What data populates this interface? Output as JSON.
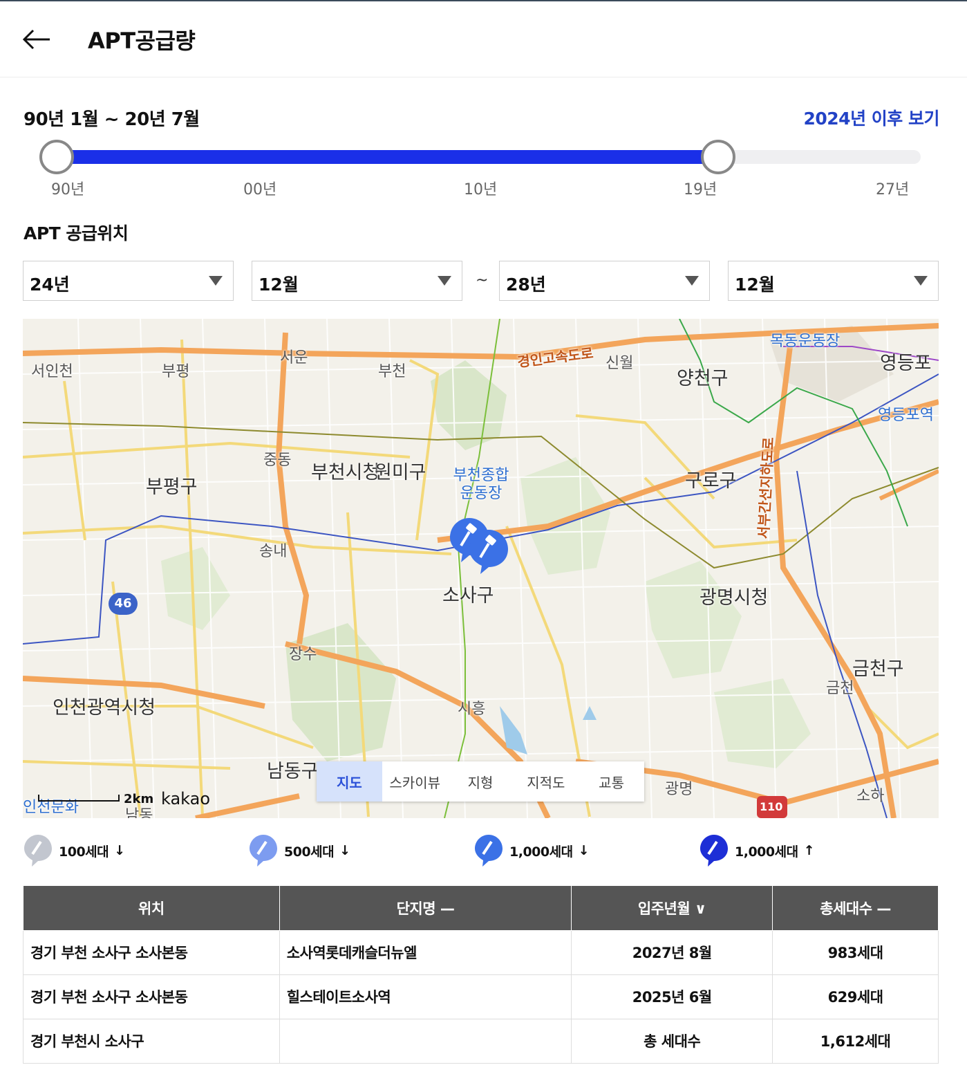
{
  "header": {
    "title": "APT공급량"
  },
  "period": {
    "label": "90년 1월 ~ 20년 7월",
    "after_link": "2024년 이후 보기",
    "ticks": [
      "90년",
      "00년",
      "10년",
      "19년",
      "27년"
    ]
  },
  "location": {
    "title": "APT 공급위치",
    "start_year": "24년",
    "start_month": "12월",
    "separator": "~",
    "end_year": "28년",
    "end_month": "12월"
  },
  "map": {
    "labels": {
      "seoincheon": "서인천",
      "bupyeong_ic": "부평",
      "seoun": "서운",
      "bucheon_ic": "부천",
      "gyeongin_road": "경인고속도로",
      "sinwol": "신월",
      "mokdong": "목동운동장",
      "yangcheon": "양천구",
      "yeongdeungpo": "영등포",
      "yeongdeungpo_station": "영등포역",
      "jungdong": "중동",
      "bucheon_city_hall": "부천시청",
      "wonmi": "원미구",
      "sports_complex": "부천종합 운동장",
      "guro": "구로구",
      "bupyeong_gu": "부평구",
      "songnae": "송내",
      "sosa": "소사구",
      "gwangmyeong_city_hall": "광명시청",
      "seobu_road": "서부간선지하도로",
      "route46": "46",
      "jangsu": "장수",
      "geumcheon_gu": "금천구",
      "geumcheon": "금천",
      "incheon_city_hall": "인천광역시청",
      "siheung": "시흥",
      "namdong_gu": "남동구",
      "gwangmyeong": "광명",
      "route110": "110",
      "soha": "소하",
      "namdong": "남동",
      "incheon_culture": "인천문화"
    },
    "tabs": [
      "지도",
      "스카이뷰",
      "지형",
      "지적도",
      "교통"
    ],
    "active_tab": "지도",
    "scale": "2km",
    "brand": "kakao"
  },
  "legend": [
    {
      "label": "100세대",
      "arrow": "↓",
      "color": "#c2c6cf"
    },
    {
      "label": "500세대",
      "arrow": "↓",
      "color": "#7d9cf0"
    },
    {
      "label": "1,000세대",
      "arrow": "↓",
      "color": "#3b71e6"
    },
    {
      "label": "1,000세대",
      "arrow": "↑",
      "color": "#1d2ed6"
    }
  ],
  "table": {
    "headers": [
      "위치",
      "단지명 —",
      "입주년월 ∨",
      "총세대수 —"
    ],
    "rows": [
      [
        "경기 부천 소사구 소사본동",
        "소사역롯데캐슬더뉴엘",
        "2027년 8월",
        "983세대"
      ],
      [
        "경기 부천 소사구 소사본동",
        "힐스테이트소사역",
        "2025년 6월",
        "629세대"
      ],
      [
        "경기 부천시 소사구",
        "",
        "총 세대수",
        "1,612세대"
      ]
    ]
  },
  "colors": {
    "accent": "#1a2fe8",
    "link": "#2242c6",
    "table_header": "#555555"
  }
}
